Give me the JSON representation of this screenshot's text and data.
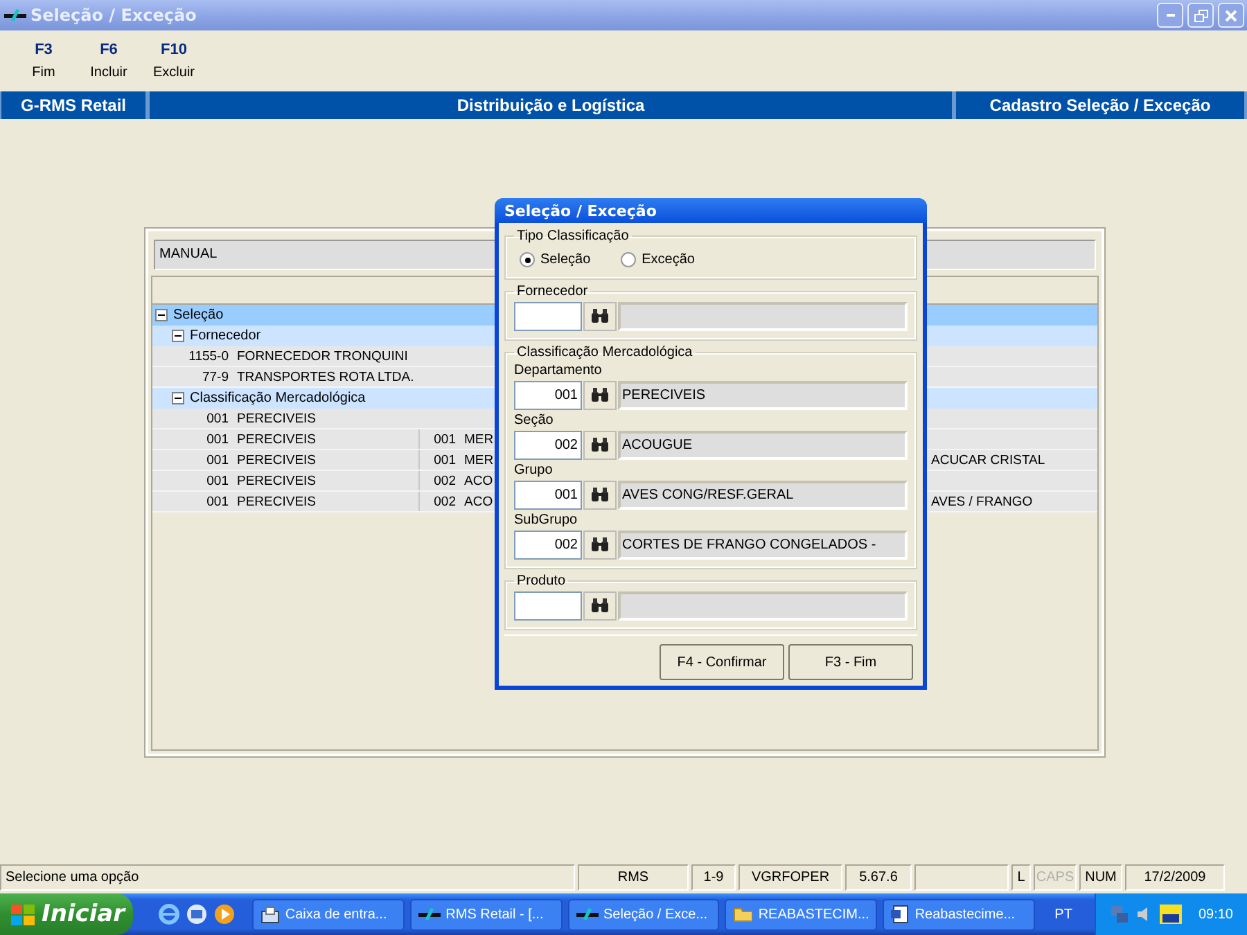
{
  "window": {
    "title": "Seleção / Exceção"
  },
  "toolbar": [
    {
      "key": "F3",
      "label": "Fim"
    },
    {
      "key": "F6",
      "label": "Incluir"
    },
    {
      "key": "F10",
      "label": "Excluir"
    }
  ],
  "header": {
    "left": "G-RMS Retail",
    "center": "Distribuição e Logística",
    "right": "Cadastro Seleção / Exceção"
  },
  "filter_field": {
    "value": "MANUAL"
  },
  "tree": [
    {
      "label": "Seleção",
      "expanded": true,
      "children": [
        {
          "label": "Fornecedor",
          "expanded": true,
          "rows": [
            {
              "code": "1155-0",
              "name": "FORNECEDOR TRONQUINI"
            },
            {
              "code": "77-9",
              "name": "TRANSPORTES ROTA LTDA."
            }
          ]
        },
        {
          "label": "Classificação Mercadológica",
          "expanded": true,
          "rows": [
            {
              "code": "001",
              "name": "PERECIVEIS"
            },
            {
              "code": "001",
              "name": "PERECIVEIS",
              "code_2": "001",
              "name_2": "MER"
            },
            {
              "code": "001",
              "name": "PERECIVEIS",
              "code_2": "001",
              "name_2": "MER",
              "column_5": "ACUCAR CRISTAL"
            },
            {
              "code": "001",
              "name": "PERECIVEIS",
              "code_2": "002",
              "name_2": "ACO"
            },
            {
              "code": "001",
              "name": "PERECIVEIS",
              "code_2": "002",
              "name_2": "ACO",
              "column_5": "AVES / FRANGO"
            }
          ]
        }
      ]
    }
  ],
  "dialog": {
    "title": "Seleção / Exceção",
    "type_group": {
      "legend": "Tipo Classificação",
      "options": [
        {
          "label": "Seleção",
          "selected": true
        },
        {
          "label": "Exceção",
          "selected": false
        }
      ]
    },
    "supplier_group": {
      "legend": "Fornecedor"
    },
    "classification_group": {
      "legend": "Classificação Mercadológica",
      "fields": [
        {
          "label": "Departamento",
          "code": "001",
          "description": "PERECIVEIS"
        },
        {
          "label": "Seção",
          "code": "002",
          "description": "ACOUGUE"
        },
        {
          "label": "Grupo",
          "code": "001",
          "description": "AVES CONG/RESF.GERAL"
        },
        {
          "label": "SubGrupo",
          "code": "002",
          "description": "CORTES DE FRANGO CONGELADOS -"
        }
      ]
    },
    "product_group": {
      "legend": "Produto"
    },
    "buttons": [
      "F4 - Confirmar",
      "F3 - Fim"
    ]
  },
  "status_bar": {
    "message": "Selecione uma opção",
    "panels": [
      {
        "kind": "text",
        "text": "RMS",
        "disabled": false
      },
      {
        "kind": "text",
        "text": "1-9",
        "disabled": false
      },
      {
        "kind": "text",
        "text": "VGRFOPER",
        "disabled": false
      },
      {
        "kind": "text",
        "text": "5.67.6",
        "disabled": false
      },
      {
        "kind": "blank"
      },
      {
        "kind": "text",
        "text": "L",
        "disabled": false
      },
      {
        "kind": "text",
        "text": "CAPS",
        "disabled": true
      },
      {
        "kind": "text",
        "text": "NUM",
        "disabled": false
      },
      {
        "kind": "text",
        "text": "17/2/2009",
        "disabled": false
      }
    ]
  },
  "taskbar": {
    "start": "Iniciar",
    "tasks": [
      {
        "kind": "mail",
        "label": "Caixa de entra..."
      },
      {
        "kind": "rms",
        "label": "RMS Retail - [..."
      },
      {
        "kind": "rms",
        "label": "Seleção / Exce..."
      },
      {
        "kind": "folder",
        "label": "REABASTECIM..."
      },
      {
        "kind": "word",
        "label": "Reabastecime..."
      }
    ],
    "language": "PT",
    "clock": "09:10"
  }
}
